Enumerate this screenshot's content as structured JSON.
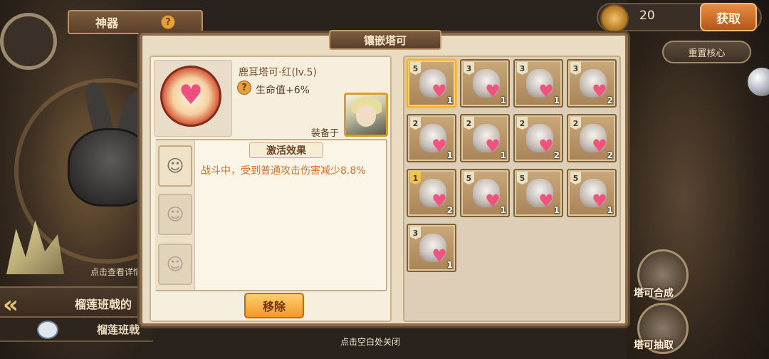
{
  "background": {
    "banner_title": "神器",
    "banner_help": "?",
    "tap_hint": "点击查看详情",
    "bottom_title": "榴莲班戟的",
    "bottom_subtitle": "榴莲班戟",
    "back_glyph": "«"
  },
  "currency": {
    "value": "20",
    "get_label": "获取"
  },
  "reset_core_label": "重置核心",
  "side_buttons": {
    "synthesize_label": "塔可合成",
    "draw_label": "塔可抽取"
  },
  "panel": {
    "title": "镶嵌塔可",
    "item_name": "鹿耳塔可·红(lv.5)",
    "stat_badge": "?",
    "stat_text": "生命值+6%",
    "equipped_label": "装备于",
    "effect_title": "激活效果",
    "effect_text": "战斗中，受到普通攻击伤害减少8.8%",
    "remove_label": "移除",
    "item_heart_glyph": "♥",
    "slot_glyph": "☺"
  },
  "grid": {
    "gem_glyph": "♥",
    "cards": [
      {
        "level": "5",
        "count": "1",
        "selected": true
      },
      {
        "level": "3",
        "count": "1",
        "selected": false
      },
      {
        "level": "3",
        "count": "1",
        "selected": false
      },
      {
        "level": "3",
        "count": "2",
        "selected": false
      },
      {
        "level": "2",
        "count": "1",
        "selected": false
      },
      {
        "level": "2",
        "count": "1",
        "selected": false
      },
      {
        "level": "2",
        "count": "2",
        "selected": false
      },
      {
        "level": "2",
        "count": "2",
        "selected": false
      },
      {
        "level": "1",
        "count": "2",
        "selected": false
      },
      {
        "level": "5",
        "count": "1",
        "selected": false
      },
      {
        "level": "5",
        "count": "1",
        "selected": false
      },
      {
        "level": "5",
        "count": "1",
        "selected": false
      },
      {
        "level": "3",
        "count": "1",
        "selected": false
      }
    ]
  },
  "close_hint": "点击空白处关闭"
}
